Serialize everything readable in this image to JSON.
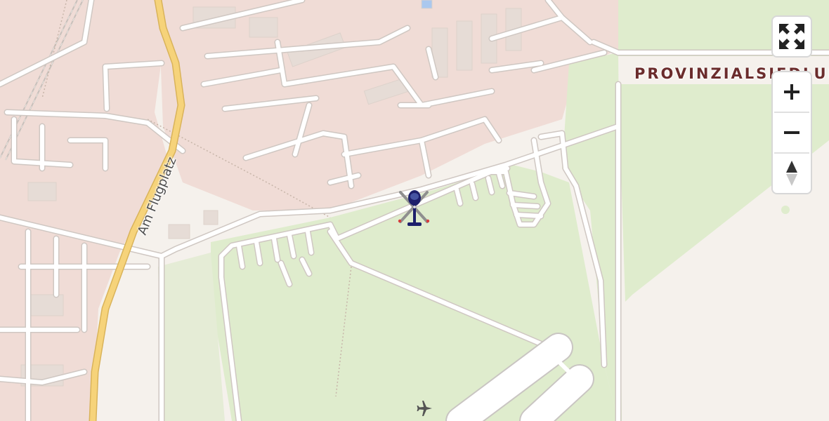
{
  "map": {
    "labels": {
      "district": "PROVINZIALSIEDLUNG",
      "street": "Am Flugplatz"
    },
    "controls": {
      "fullscreen_icon": "expand-arrows-icon",
      "zoom_in_icon": "plus-icon",
      "zoom_out_icon": "minus-icon",
      "compass_icon": "compass-arrow-icon"
    },
    "markers": {
      "helicopter_icon": "helicopter-icon",
      "airport_icon": "airplane-icon"
    },
    "colors": {
      "background": "#f5f1ec",
      "residential": "#f0dcd6",
      "grass": "#dfeccd",
      "primary_road": "#f6d37a",
      "road": "#ffffff",
      "helicopter_body": "#1d1f6b"
    }
  }
}
